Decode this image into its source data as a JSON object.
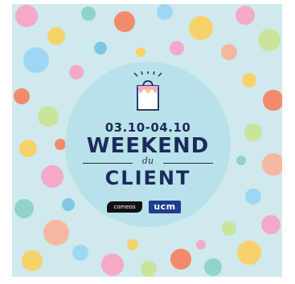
{
  "poster": {
    "dates": "03.10-04.10",
    "title_line1": "WEEKEND",
    "title_connector": "du",
    "title_line2": "CLIENT",
    "logos": [
      {
        "name": "comeos",
        "text": "comeos"
      },
      {
        "name": "ucm",
        "text": "ucm"
      }
    ]
  },
  "colors": {
    "background": "#cfe9ee",
    "badge": "#b9e1ea",
    "text": "#1c2a5a",
    "confetti": [
      "#f5a9c8",
      "#f7d26a",
      "#8fd3c9",
      "#f28a6b",
      "#9fd7f2",
      "#c9e59a",
      "#f6b7a0",
      "#7ec8e3"
    ]
  }
}
